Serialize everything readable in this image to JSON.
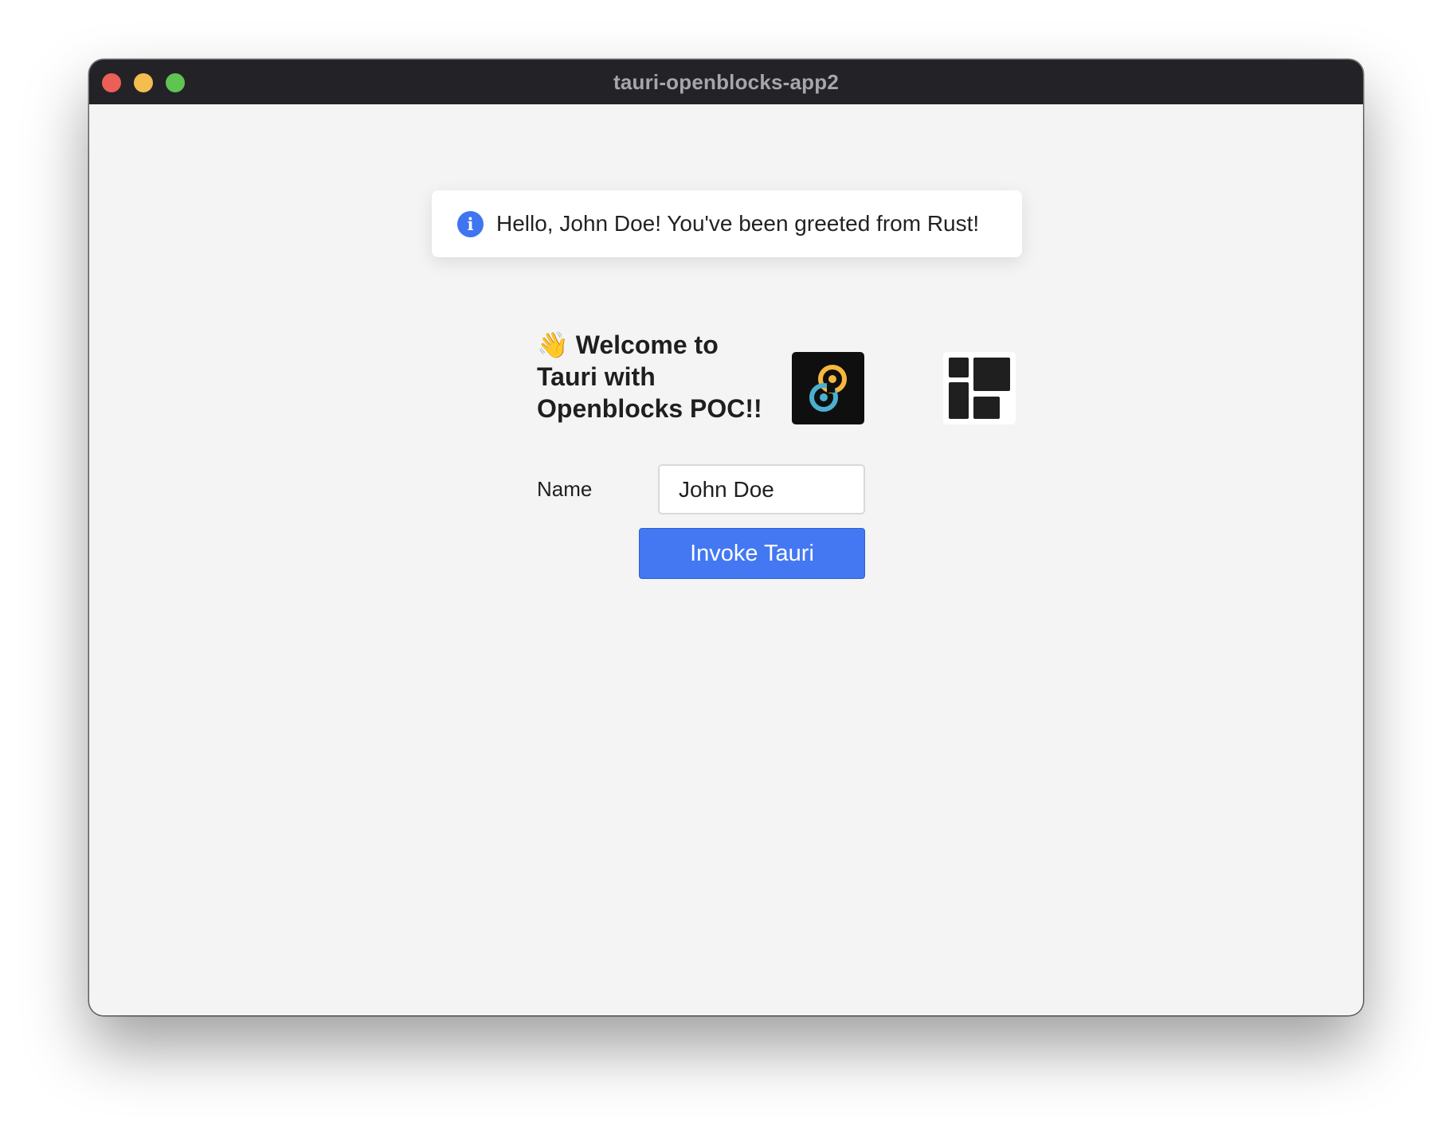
{
  "window": {
    "title": "tauri-openblocks-app2"
  },
  "toast": {
    "icon": "info-icon",
    "icon_glyph": "i",
    "message": "Hello, John Doe! You've been greeted from Rust!"
  },
  "welcome": {
    "wave_emoji": "👋",
    "heading": "Welcome to Tauri with Openblocks POC!!",
    "tauri_logo": "tauri-logo",
    "plus": "+",
    "openblocks_logo": "openblocks-logo"
  },
  "form": {
    "name_label": "Name",
    "name_value": "John Doe",
    "invoke_button_label": "Invoke Tauri"
  },
  "colors": {
    "accent": "#4378f2",
    "titlebar": "#232227",
    "content_bg": "#f4f4f4",
    "close": "#ec5f57",
    "minimize": "#f4bd4f",
    "maximize": "#5fc452",
    "tauri_yellow": "#f6b73c",
    "tauri_blue": "#4ab0cf"
  }
}
